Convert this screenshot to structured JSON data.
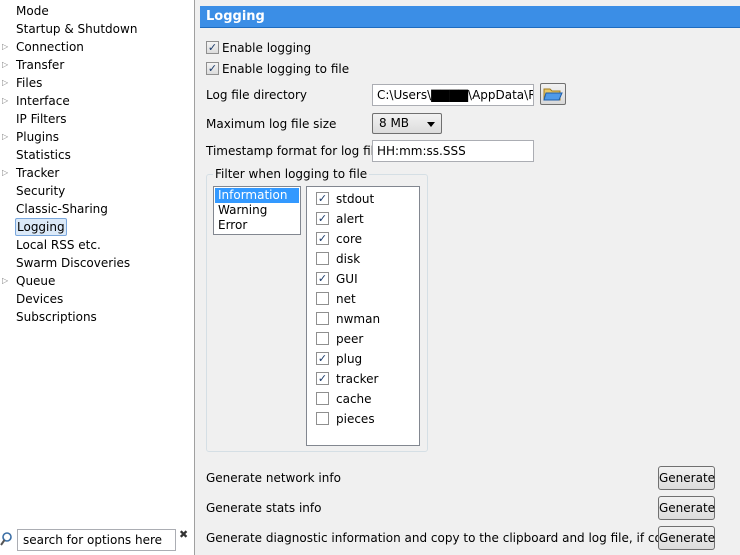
{
  "sidebar": {
    "items": [
      {
        "label": "Mode",
        "expandable": false
      },
      {
        "label": "Startup & Shutdown",
        "expandable": false
      },
      {
        "label": "Connection",
        "expandable": true
      },
      {
        "label": "Transfer",
        "expandable": true
      },
      {
        "label": "Files",
        "expandable": true
      },
      {
        "label": "Interface",
        "expandable": true
      },
      {
        "label": "IP Filters",
        "expandable": false
      },
      {
        "label": "Plugins",
        "expandable": true
      },
      {
        "label": "Statistics",
        "expandable": false
      },
      {
        "label": "Tracker",
        "expandable": true
      },
      {
        "label": "Security",
        "expandable": false
      },
      {
        "label": "Classic-Sharing",
        "expandable": false
      },
      {
        "label": "Logging",
        "expandable": false,
        "selected": true
      },
      {
        "label": "Local RSS etc.",
        "expandable": false
      },
      {
        "label": "Swarm Discoveries",
        "expandable": false
      },
      {
        "label": "Queue",
        "expandable": true
      },
      {
        "label": "Devices",
        "expandable": false
      },
      {
        "label": "Subscriptions",
        "expandable": false
      }
    ],
    "search": {
      "value": "search for options here",
      "clear": "✖"
    }
  },
  "main": {
    "title": "Logging",
    "enable_logging": {
      "label": "Enable logging",
      "checked": true
    },
    "enable_logging_file": {
      "label": "Enable logging to file",
      "checked": true
    },
    "log_dir": {
      "label": "Log file directory",
      "value": "C:\\Users\\▇▇▇▇\\AppData\\Ro"
    },
    "max_size": {
      "label": "Maximum log file size",
      "value": "8 MB"
    },
    "timestamp": {
      "label": "Timestamp format for log files",
      "value": "HH:mm:ss.SSS"
    },
    "filter": {
      "title": "Filter when logging to file",
      "levels": [
        "Information",
        "Warning",
        "Error"
      ],
      "selected_level": 0,
      "categories": [
        {
          "label": "stdout",
          "checked": true
        },
        {
          "label": "alert",
          "checked": true
        },
        {
          "label": "core",
          "checked": true
        },
        {
          "label": "disk",
          "checked": false
        },
        {
          "label": "GUI",
          "checked": true
        },
        {
          "label": "net",
          "checked": false
        },
        {
          "label": "nwman",
          "checked": false
        },
        {
          "label": "peer",
          "checked": false
        },
        {
          "label": "plug",
          "checked": true
        },
        {
          "label": "tracker",
          "checked": true
        },
        {
          "label": "cache",
          "checked": false
        },
        {
          "label": "pieces",
          "checked": false
        }
      ]
    },
    "actions": [
      {
        "label": "Generate network info",
        "button": "Generate"
      },
      {
        "label": "Generate stats info",
        "button": "Generate"
      },
      {
        "label": "Generate diagnostic information and copy to the clipboard and log file, if configured",
        "button": "Generate"
      }
    ]
  },
  "icons": {
    "expand_arrow": "triangle-right-icon",
    "search": "magnifier-icon",
    "browse": "folder-open-icon",
    "dropdown": "caret-down-icon"
  }
}
